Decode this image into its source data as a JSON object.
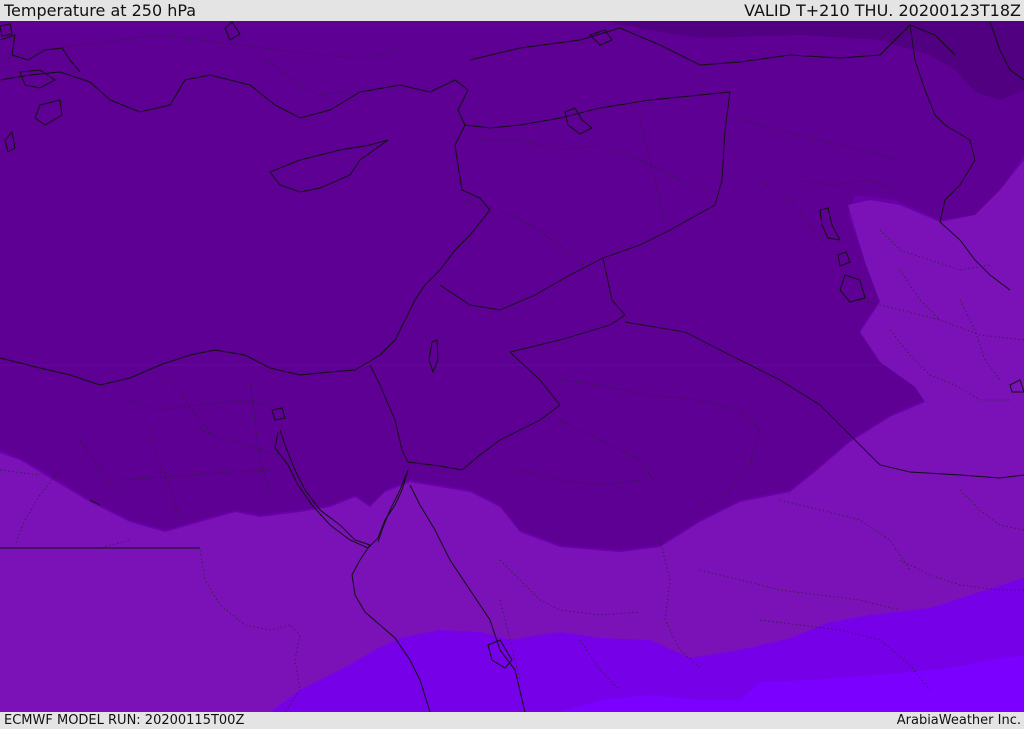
{
  "header": {
    "title": "Temperature at 250 hPa",
    "valid": "VALID T+210 THU. 20200123T18Z"
  },
  "footer": {
    "model_run": "ECMWF MODEL RUN: 20200115T00Z",
    "credit": "ArabiaWeather Inc."
  },
  "map": {
    "colors": {
      "band_coldest": "#520082",
      "band_1": "#5e0094",
      "band_2": "#6a00a8",
      "band_3": "#7a12b8",
      "band_4": "#7600e8",
      "band_5": "#7b00ff",
      "coastline": "#111111",
      "border": "#111111"
    }
  }
}
